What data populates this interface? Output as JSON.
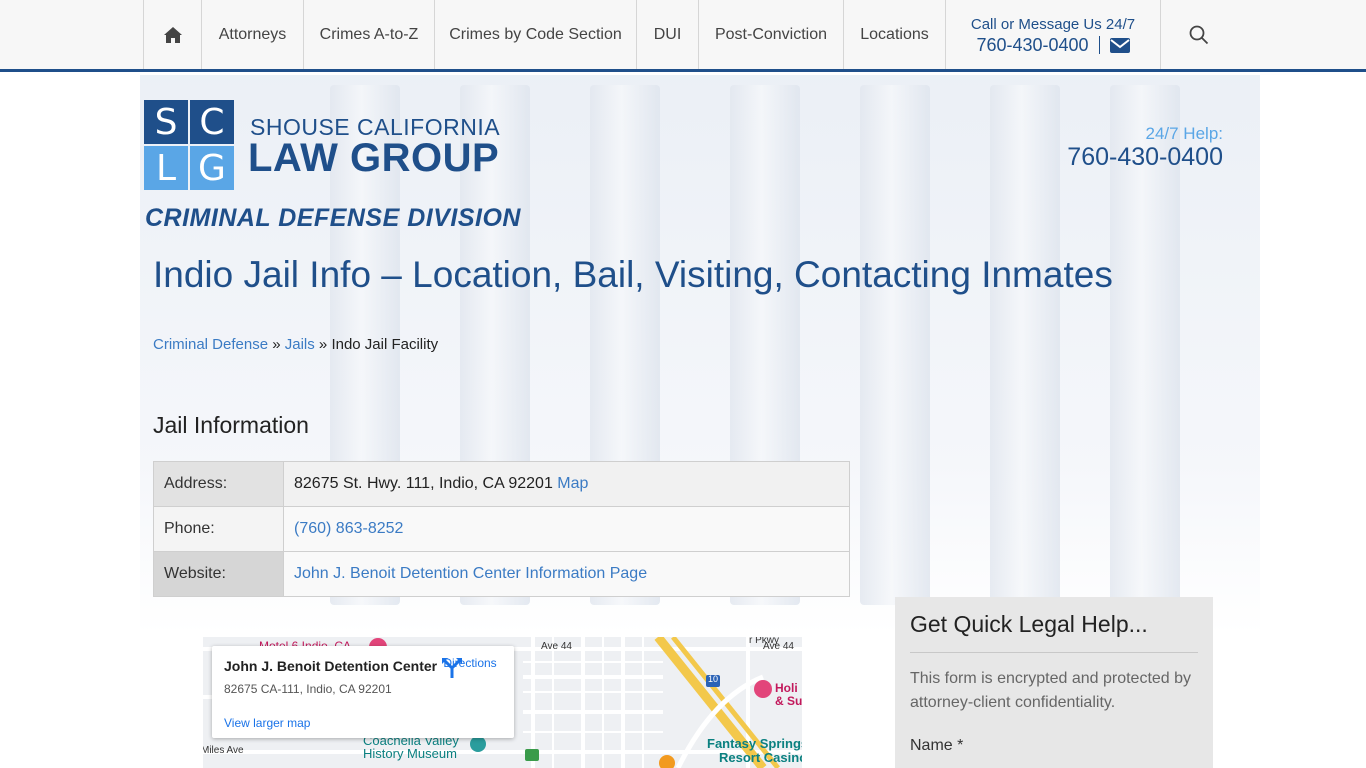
{
  "nav": {
    "items": [
      {
        "label": "Attorneys"
      },
      {
        "label": "Crimes A-to-Z"
      },
      {
        "label": "Crimes by Code Section"
      },
      {
        "label": "DUI"
      },
      {
        "label": "Post-Conviction"
      },
      {
        "label": "Locations"
      }
    ],
    "call_label": "Call or Message Us 24/7",
    "call_phone": "760-430-0400"
  },
  "icons": {
    "home": "home-icon",
    "mail": "envelope-icon",
    "search": "search-icon"
  },
  "logo": {
    "letters": [
      "S",
      "C",
      "L",
      "G"
    ],
    "line1": "SHOUSE CALIFORNIA",
    "line2": "LAW GROUP",
    "division": "CRIMINAL DEFENSE DIVISION"
  },
  "help": {
    "label": "24/7 Help:",
    "phone": "760-430-0400"
  },
  "page": {
    "title": "Indio Jail Info – Location, Bail, Visiting, Contacting Inmates"
  },
  "breadcrumb": {
    "crumb1": "Criminal Defense",
    "sep": "»",
    "crumb2": "Jails",
    "current": "Indo Jail Facility"
  },
  "jail": {
    "heading": "Jail Information",
    "address_label": "Address:",
    "address_value": "82675 St. Hwy. 111, Indio, CA 92201",
    "map_link": "Map",
    "phone_label": "Phone:",
    "phone_value": "(760) 863-8252",
    "website_label": "Website:",
    "website_value": "John J. Benoit Detention Center Information Page"
  },
  "map": {
    "place_title": "John J. Benoit Detention Center",
    "place_address": "82675 CA-111, Indio, CA 92201",
    "directions": "Directions",
    "larger_map": "View larger map",
    "labels": {
      "motel": "Motel 6 Indio, CA",
      "ave44_a": "Ave 44",
      "ave44_b": "Ave 44",
      "miles": "Miles Ave",
      "museum1": "Coachella Valley",
      "museum2": "History Museum",
      "fantasy1": "Fantasy Springs",
      "fantasy2": "Resort Casino",
      "holiday1": "Holi",
      "holiday2": "& Su",
      "pkwy": "r Pkwy",
      "hwy10": "10",
      "hwy111": "10"
    }
  },
  "sidebar": {
    "title": "Get Quick Legal Help...",
    "note": "This form is encrypted and protected by attorney-client confidentiality.",
    "name_label": "Name *"
  },
  "colors": {
    "brand_dark": "#1f4f8a",
    "brand_light": "#5aa6e6",
    "link": "#3b7bc4"
  }
}
